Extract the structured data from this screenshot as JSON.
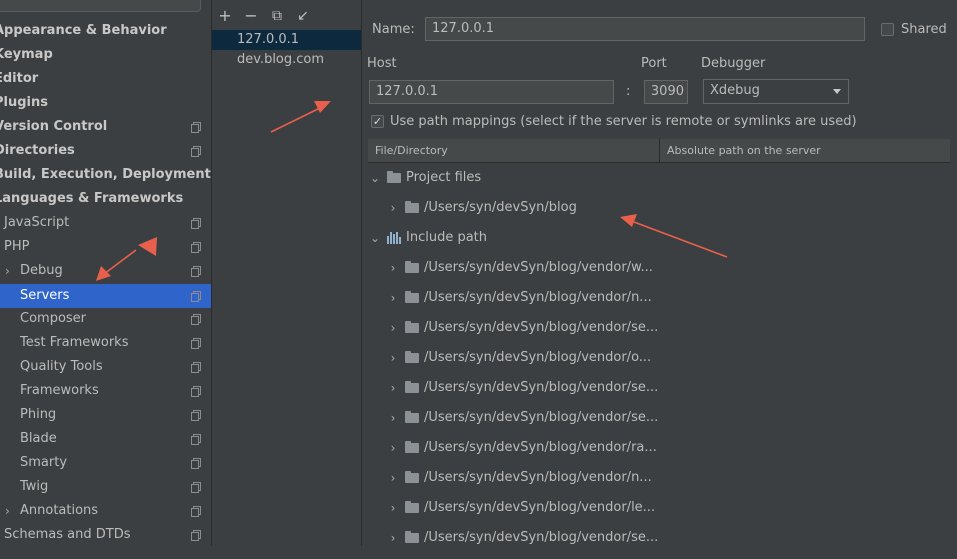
{
  "sidebar": {
    "items": [
      {
        "label": "Appearance & Behavior",
        "chev": "",
        "copy": false
      },
      {
        "label": "Keymap",
        "chev": "",
        "copy": false
      },
      {
        "label": "Editor",
        "chev": "",
        "copy": false
      },
      {
        "label": "Plugins",
        "chev": "",
        "copy": false
      },
      {
        "label": "Version Control",
        "chev": "",
        "copy": true
      },
      {
        "label": "Directories",
        "chev": "",
        "copy": true
      },
      {
        "label": "Build, Execution, Deployment",
        "chev": "",
        "copy": false
      },
      {
        "label": "Languages & Frameworks",
        "chev": "",
        "copy": false
      },
      {
        "label": "JavaScript",
        "chev": "",
        "copy": true
      },
      {
        "label": "PHP",
        "chev": "",
        "copy": true
      },
      {
        "label": "Debug",
        "chev": "›",
        "copy": true
      },
      {
        "label": "Servers",
        "chev": "",
        "copy": true
      },
      {
        "label": "Composer",
        "chev": "",
        "copy": true
      },
      {
        "label": "Test Frameworks",
        "chev": "",
        "copy": true
      },
      {
        "label": "Quality Tools",
        "chev": "",
        "copy": true
      },
      {
        "label": "Frameworks",
        "chev": "",
        "copy": true
      },
      {
        "label": "Phing",
        "chev": "",
        "copy": true
      },
      {
        "label": "Blade",
        "chev": "",
        "copy": true
      },
      {
        "label": "Smarty",
        "chev": "",
        "copy": true
      },
      {
        "label": "Twig",
        "chev": "",
        "copy": true
      },
      {
        "label": "Annotations",
        "chev": "›",
        "copy": true
      },
      {
        "label": "Schemas and DTDs",
        "chev": "",
        "copy": true
      }
    ]
  },
  "toolbar": {
    "add": "+",
    "remove": "−",
    "copy": "⧉",
    "import": "↙"
  },
  "servers": {
    "items": [
      "127.0.0.1",
      "dev.blog.com"
    ]
  },
  "form": {
    "name_label": "Name:",
    "name_value": "127.0.0.1",
    "shared_label": "Shared",
    "host_label": "Host",
    "host_value": "127.0.0.1",
    "colon": ":",
    "port_label": "Port",
    "port_value": "3090",
    "debugger_label": "Debugger",
    "debugger_value": "Xdebug",
    "path_mappings_label": "Use path mappings (select if the server is remote or symlinks are used)",
    "check_mark": "✓"
  },
  "table": {
    "col1": "File/Directory",
    "col2": "Absolute path on the server",
    "rows": [
      {
        "label": "Project files",
        "chev": "⌄"
      },
      {
        "label": "/Users/syn/devSyn/blog",
        "chev": "›"
      },
      {
        "label": "Include path",
        "chev": "⌄"
      },
      {
        "label": "/Users/syn/devSyn/blog/vendor/w...",
        "chev": "›"
      },
      {
        "label": "/Users/syn/devSyn/blog/vendor/n...",
        "chev": "›"
      },
      {
        "label": "/Users/syn/devSyn/blog/vendor/se...",
        "chev": "›"
      },
      {
        "label": "/Users/syn/devSyn/blog/vendor/o...",
        "chev": "›"
      },
      {
        "label": "/Users/syn/devSyn/blog/vendor/se...",
        "chev": "›"
      },
      {
        "label": "/Users/syn/devSyn/blog/vendor/se...",
        "chev": "›"
      },
      {
        "label": "/Users/syn/devSyn/blog/vendor/ra...",
        "chev": "›"
      },
      {
        "label": "/Users/syn/devSyn/blog/vendor/n...",
        "chev": "›"
      },
      {
        "label": "/Users/syn/devSyn/blog/vendor/le...",
        "chev": "›"
      },
      {
        "label": "/Users/syn/devSyn/blog/vendor/se...",
        "chev": "›"
      }
    ]
  },
  "colors": {
    "background": "#3c3f41",
    "selection": "#2f65ca",
    "annotation_arrow": "#e8604c"
  }
}
